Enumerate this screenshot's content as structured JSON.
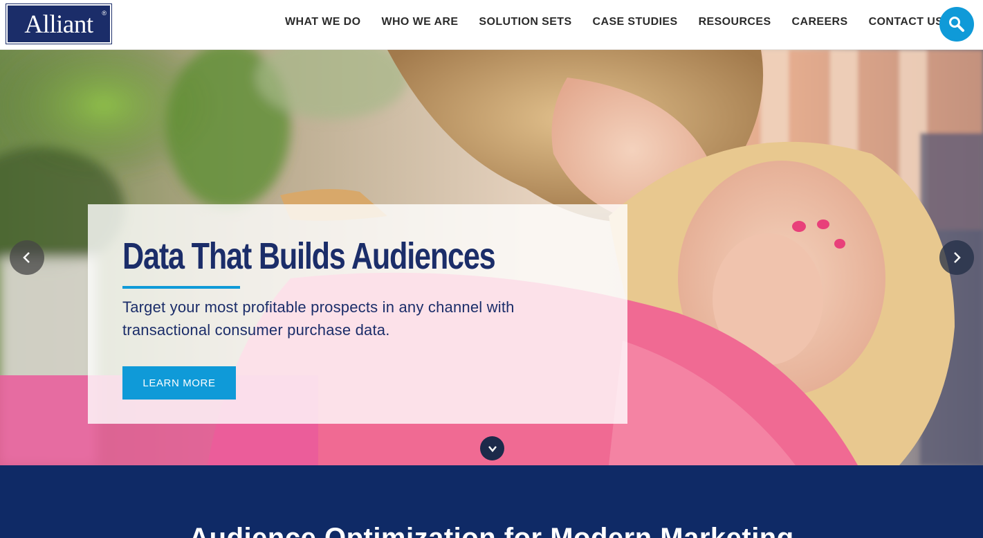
{
  "header": {
    "logo_text": "Alliant",
    "logo_mark": "®",
    "nav": [
      {
        "label": "WHAT WE DO"
      },
      {
        "label": "WHO WE ARE"
      },
      {
        "label": "SOLUTION SETS"
      },
      {
        "label": "CASE STUDIES"
      },
      {
        "label": "RESOURCES"
      },
      {
        "label": "CAREERS"
      },
      {
        "label": "CONTACT US"
      }
    ],
    "search_icon": "search-icon"
  },
  "hero": {
    "title": "Data That Builds Audiences",
    "description": "Target your most profitable prospects in any channel with transactional consumer purchase data.",
    "cta_label": "LEARN MORE",
    "prev_icon": "chevron-left-icon",
    "next_icon": "chevron-right-icon",
    "scroll_icon": "chevron-down-icon"
  },
  "section": {
    "title": "Audience Optimization for Modern Marketing"
  },
  "colors": {
    "brand_navy": "#1b2d69",
    "accent_blue": "#0f9ad8",
    "section_bg": "#0f2a66"
  }
}
